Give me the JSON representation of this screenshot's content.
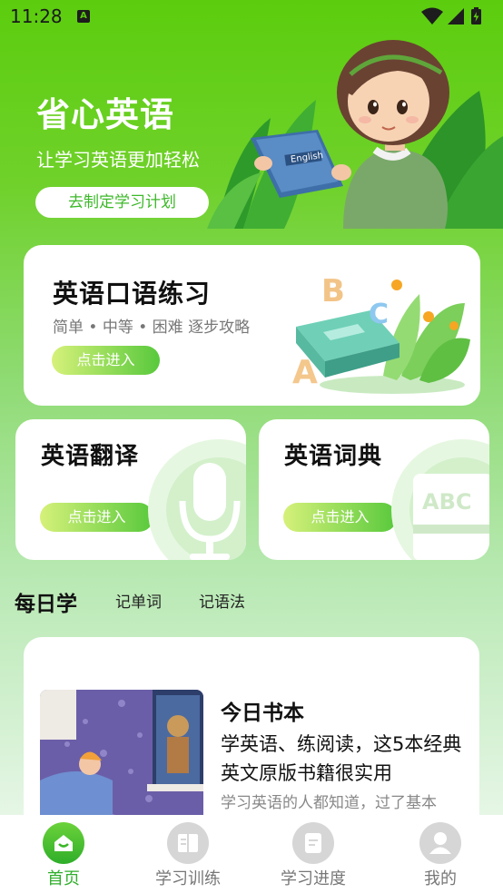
{
  "status_bar": {
    "time": "11:28",
    "notification_icon": "A",
    "icons": [
      "wifi-icon",
      "signal-icon",
      "battery-charging-icon"
    ]
  },
  "hero": {
    "title": "省心英语",
    "subtitle": "让学习英语更加轻松",
    "plan_button": "去制定学习计划",
    "book_text": "English"
  },
  "oral_card": {
    "title": "英语口语练习",
    "meta": "简单 • 中等 • 困难 逐步攻略",
    "button": "点击进入"
  },
  "translate_card": {
    "title": "英语翻译",
    "button": "点击进入"
  },
  "dict_card": {
    "title": "英语词典",
    "button": "点击进入",
    "icon_text": "ABC"
  },
  "daily": {
    "tabs": [
      "每日学",
      "记单词",
      "记语法"
    ]
  },
  "article": {
    "section": "今日书本",
    "headline": "学英语、练阅读，这5本经典英文原版书籍很实用",
    "description": "学习英语的人都知道，过了基本"
  },
  "bottom_nav": {
    "items": [
      {
        "label": "首页",
        "icon": "home-icon",
        "active": true
      },
      {
        "label": "学习训练",
        "icon": "book-icon",
        "active": false
      },
      {
        "label": "学习进度",
        "icon": "progress-icon",
        "active": false
      },
      {
        "label": "我的",
        "icon": "user-icon",
        "active": false
      }
    ]
  },
  "colors": {
    "primary": "#3db82a",
    "header": "#5ccd0e",
    "button_gradient": [
      "#d6f17a",
      "#58c93c"
    ]
  }
}
